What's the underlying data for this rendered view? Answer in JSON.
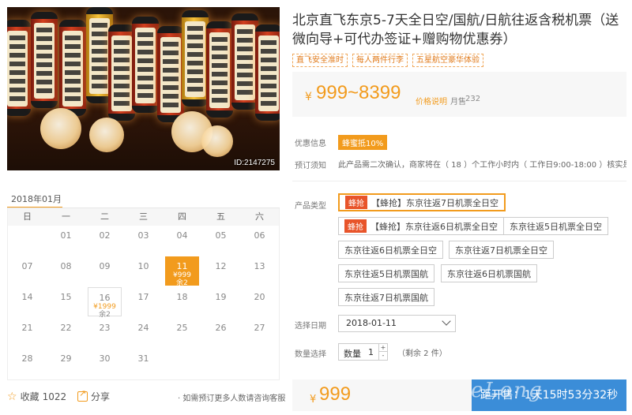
{
  "product": {
    "title": "北京直飞东京5-7天全日空/国航/日航往返含税机票（送微向导+可代办签证+赠购物优惠券）",
    "tags": [
      "直飞安全准时",
      "每人两件行李",
      "五星航空豪华体验"
    ],
    "image_id": "ID:2147275"
  },
  "price": {
    "currency": "¥",
    "range": "999~8399",
    "desc_label": "价格说明",
    "sold_label": "月售",
    "sold_count": "232"
  },
  "promo": {
    "label": "优惠信息",
    "badge": "蜂蜜抵10%"
  },
  "notice": {
    "label": "预订须知",
    "text": "此产品需二次确认，商家将在（ 18 ）个工作小时内（ 工作日9:00-18:00 ）核实是否有位"
  },
  "product_type": {
    "label": "产品类型",
    "options": [
      {
        "flag": "蜂抢",
        "label": "【蜂抢】东京往返7日机票全日空",
        "selected": true
      },
      {
        "flag": "蜂抢",
        "label": "【蜂抢】东京往返6日机票全日空",
        "selected": false
      },
      {
        "label": "东京往返5日机票全日空",
        "selected": false
      },
      {
        "label": "东京往返6日机票全日空",
        "selected": false
      },
      {
        "label": "东京往返7日机票全日空",
        "selected": false
      },
      {
        "label": "东京往返5日机票国航",
        "selected": false
      },
      {
        "label": "东京往返6日机票国航",
        "selected": false
      },
      {
        "label": "东京往返7日机票国航",
        "selected": false
      }
    ]
  },
  "date": {
    "label": "选择日期",
    "value": "2018-01-11"
  },
  "quantity": {
    "label": "数量选择",
    "field_label": "数量",
    "value": "1",
    "up": "+",
    "down": "-",
    "remaining": "（剩余 2 件）"
  },
  "calendar": {
    "month": "2018年01月",
    "weekdays": [
      "日",
      "一",
      "二",
      "三",
      "四",
      "五",
      "六"
    ],
    "rows": [
      [
        "",
        "01",
        "02",
        "03",
        "04",
        "05",
        "06"
      ],
      [
        "07",
        "08",
        "09",
        "10",
        "11",
        "12",
        "13"
      ],
      [
        "14",
        "15",
        "16",
        "17",
        "18",
        "19",
        "20"
      ],
      [
        "21",
        "22",
        "23",
        "24",
        "25",
        "26",
        "27"
      ],
      [
        "28",
        "29",
        "30",
        "31",
        "",
        "",
        ""
      ]
    ],
    "active": {
      "day": "11",
      "price": "¥999",
      "remain": "余2"
    },
    "priced": {
      "day": "16",
      "price": "¥1999",
      "remain": "余2"
    }
  },
  "actions": {
    "favorite_label": "收藏",
    "favorite_count": "1022",
    "share_label": "分享",
    "consult": "· 如需预订更多人数请咨询客服"
  },
  "buy": {
    "currency": "¥",
    "price": "999",
    "button": "距开售：1天15时53分32秒"
  },
  "watermark": "eLong"
}
